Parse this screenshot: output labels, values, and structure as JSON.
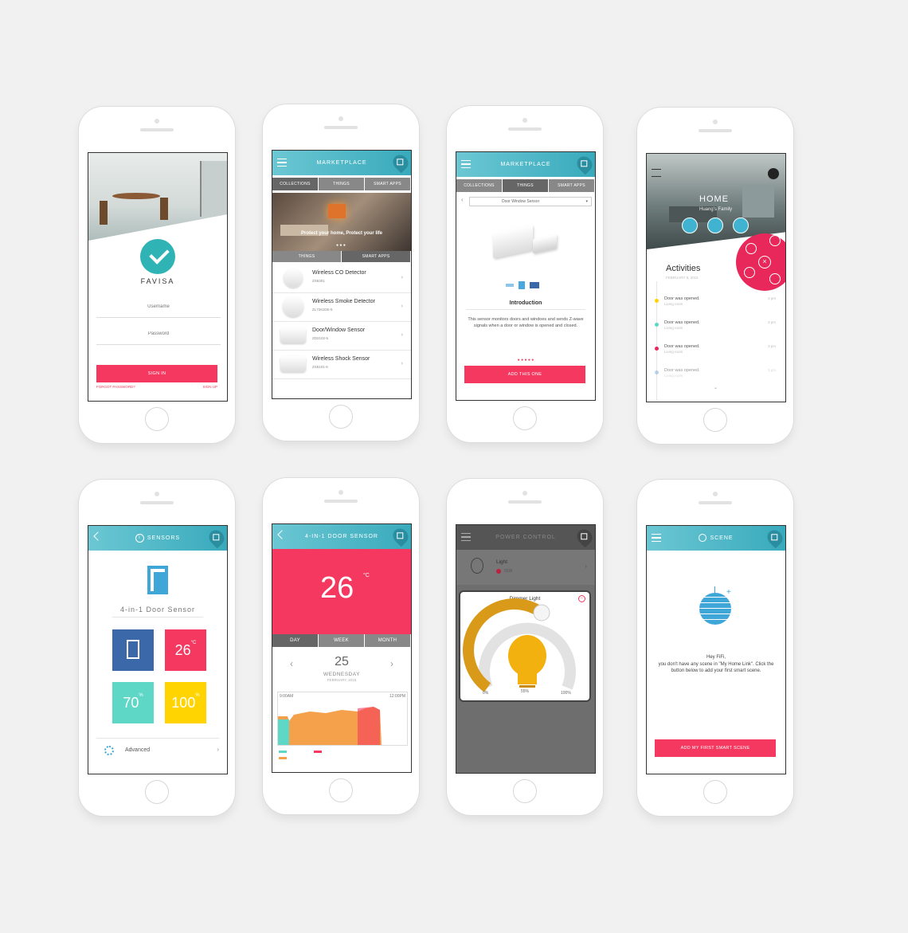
{
  "colors": {
    "teal": "#38aabc",
    "pink": "#f5385f",
    "blue": "#3a68a8",
    "mint": "#5ed7c6",
    "yellow": "#ffd400",
    "orange": "#f5a04a"
  },
  "login": {
    "brand": "FAVISA",
    "username_placeholder": "Username",
    "password_placeholder": "Password",
    "sign_in": "SIGN IN",
    "forgot": "FORGOT PASSWORD?",
    "sign_up": "SIGN UP"
  },
  "market": {
    "title": "MARKETPLACE",
    "tabs": [
      "COLLECTIONS",
      "THINGS",
      "SMART APPS"
    ],
    "banner": "Protect your home, Protect your life",
    "subtabs": [
      "THINGS",
      "SMART APPS"
    ],
    "items": [
      {
        "name": "Wireless CO Detector",
        "code": "ZS6301"
      },
      {
        "name": "Wireless Smoke Detector",
        "code": "ZL7261DE-5"
      },
      {
        "name": "Door/Window Sensor",
        "code": "ZD2102-5"
      },
      {
        "name": "Wireless Shock Sensor",
        "code": "ZS5101-5"
      }
    ]
  },
  "detail": {
    "title": "MARKETPLACE",
    "tabs": [
      "COLLECTIONS",
      "THINGS",
      "SMART APPS"
    ],
    "select": "Door Window Sensor",
    "heading": "Introduction",
    "desc": "This sensor monitors doors and windoes and sends Z-wave signals when a door or window is opened and closed.",
    "button": "ADD THIS ONE"
  },
  "home": {
    "title": "HOME",
    "subtitle": "Huang's Family",
    "activities_title": "Activities",
    "date": "FEBRUARY 8, 2015",
    "activities": [
      {
        "text": "Door was opened.",
        "room": "Living room",
        "time": "3 pm"
      },
      {
        "text": "Door was opened.",
        "room": "Living room",
        "time": "3 pm"
      },
      {
        "text": "Door was opened.",
        "room": "Living room",
        "time": "3 pm"
      },
      {
        "text": "Door was opened.",
        "room": "Living room",
        "time": "3 pm"
      }
    ]
  },
  "sensors": {
    "title": "SENSORS",
    "device": "4-in-1 Door Sensor",
    "temp": "26",
    "temp_unit": "°C",
    "humidity": "70",
    "light": "100",
    "unit_pct": "%",
    "advanced": "Advanced"
  },
  "door": {
    "title": "4-IN-1 DOOR SENSOR",
    "temp": "26",
    "unit": "°C",
    "tabs": [
      "DAY",
      "WEEK",
      "MONTH"
    ],
    "day": "25",
    "weekday": "WEDNESDAY",
    "month": "FEBRUARY, 2015",
    "t_start": "9:00AM",
    "t_end": "12:00PM"
  },
  "power": {
    "title": "POWER CONTROL",
    "light": "Light",
    "watts": "55W",
    "dimmer": "Dimmer Light",
    "min": "0%",
    "val": "55%",
    "max": "100%"
  },
  "scene": {
    "title": "SCENE",
    "greet": "Hey FiFi,",
    "msg": "you don't have any scene in \"My Home Link\". Click the button below to add your first smart scene.",
    "button": "ADD MY FIRST SMART SCENE"
  }
}
